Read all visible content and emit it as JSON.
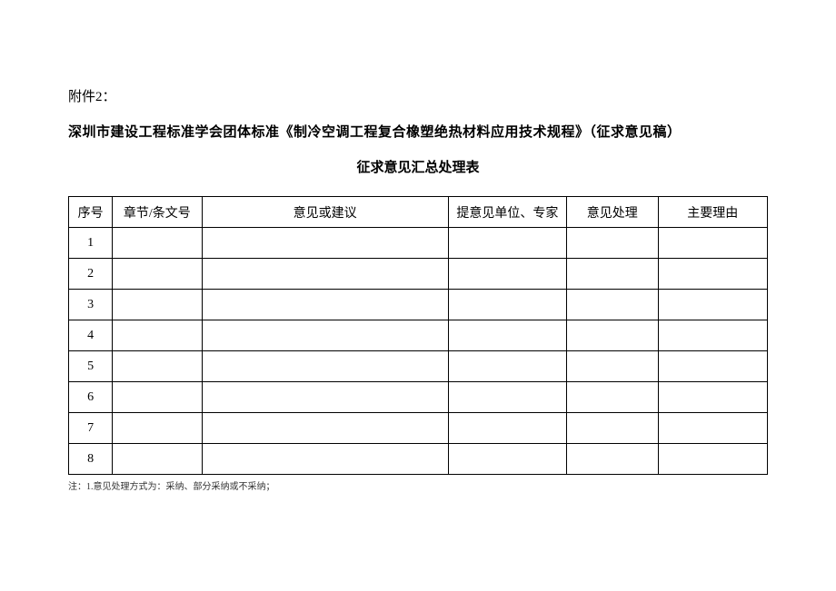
{
  "attachment_label": "附件2：",
  "main_title": "深圳市建设工程标准学会团体标准《制冷空调工程复合橡塑绝热材料应用技术规程》（征求意见稿）",
  "sub_title": "征求意见汇总处理表",
  "headers": {
    "seq": "序号",
    "chapter": "章节/条文号",
    "suggestion": "意见或建议",
    "unit": "提意见单位、专家",
    "process": "意见处理",
    "reason": "主要理由"
  },
  "rows": [
    {
      "seq": "1",
      "chapter": "",
      "suggestion": "",
      "unit": "",
      "process": "",
      "reason": ""
    },
    {
      "seq": "2",
      "chapter": "",
      "suggestion": "",
      "unit": "",
      "process": "",
      "reason": ""
    },
    {
      "seq": "3",
      "chapter": "",
      "suggestion": "",
      "unit": "",
      "process": "",
      "reason": ""
    },
    {
      "seq": "4",
      "chapter": "",
      "suggestion": "",
      "unit": "",
      "process": "",
      "reason": ""
    },
    {
      "seq": "5",
      "chapter": "",
      "suggestion": "",
      "unit": "",
      "process": "",
      "reason": ""
    },
    {
      "seq": "6",
      "chapter": "",
      "suggestion": "",
      "unit": "",
      "process": "",
      "reason": ""
    },
    {
      "seq": "7",
      "chapter": "",
      "suggestion": "",
      "unit": "",
      "process": "",
      "reason": ""
    },
    {
      "seq": "8",
      "chapter": "",
      "suggestion": "",
      "unit": "",
      "process": "",
      "reason": ""
    }
  ],
  "footnote": "注：1.意见处理方式为：采纳、部分采纳或不采纳；"
}
